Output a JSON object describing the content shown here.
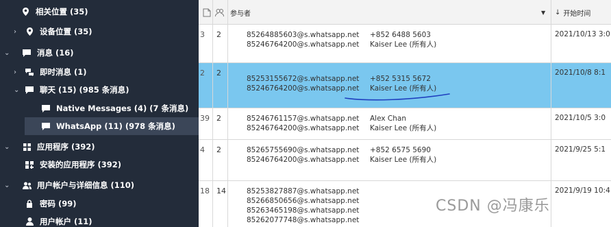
{
  "sidebar": {
    "items": [
      {
        "label": "相关位置 (35)",
        "icon": "location-pin-icon"
      },
      {
        "label": "设备位置 (35)",
        "icon": "location-pin-icon"
      },
      {
        "label": "消息 (16)",
        "icon": "message-icon"
      },
      {
        "label": "即时消息 (1)",
        "icon": "chat-bubbles-icon"
      },
      {
        "label": "聊天 (15) (985 条消息)",
        "icon": "message-icon"
      },
      {
        "label": "Native Messages (4) (7 条消息)",
        "icon": "message-icon"
      },
      {
        "label": "WhatsApp (11) (978 条消息)",
        "icon": "message-icon"
      },
      {
        "label": "应用程序 (392)",
        "icon": "apps-grid-icon"
      },
      {
        "label": "安装的应用程序 (392)",
        "icon": "installed-apps-icon"
      },
      {
        "label": "用户帐户与详细信息 (110)",
        "icon": "users-icon"
      },
      {
        "label": "密码 (99)",
        "icon": "lock-icon"
      },
      {
        "label": "用户帐户 (11)",
        "icon": "user-icon"
      }
    ]
  },
  "grid": {
    "columns": {
      "participants": "参与者",
      "start_time": "开始时间",
      "sort_indicator": "↓"
    },
    "rows": [
      {
        "edge": "3",
        "count": "2",
        "participants": [
          {
            "addr": "85264885603@s.whatsapp.net",
            "name": "+852 6488 5603"
          },
          {
            "addr": "85246764200@s.whatsapp.net",
            "name": "Kaiser Lee (所有人)"
          }
        ],
        "time": "2021/10/13 3:0"
      },
      {
        "edge": "2",
        "count": "2",
        "participants": [
          {
            "addr": "85253155672@s.whatsapp.net",
            "name": "+852 5315 5672"
          },
          {
            "addr": "85246764200@s.whatsapp.net",
            "name": "Kaiser Lee (所有人)"
          }
        ],
        "time": "2021/10/8 8:1"
      },
      {
        "edge": "39",
        "count": "2",
        "participants": [
          {
            "addr": "85246761157@s.whatsapp.net",
            "name": "Alex Chan"
          },
          {
            "addr": "85246764200@s.whatsapp.net",
            "name": "Kaiser Lee (所有人)"
          }
        ],
        "time": "2021/10/5 3:0"
      },
      {
        "edge": "4",
        "count": "2",
        "participants": [
          {
            "addr": "85265755690@s.whatsapp.net",
            "name": "+852 6575 5690"
          },
          {
            "addr": "85246764200@s.whatsapp.net",
            "name": "Kaiser Lee (所有人)"
          }
        ],
        "time": "2021/9/25 5:1"
      },
      {
        "edge": "18",
        "count": "14",
        "participants": [
          {
            "addr": "85253827887@s.whatsapp.net",
            "name": ""
          },
          {
            "addr": "85266850656@s.whatsapp.net",
            "name": ""
          },
          {
            "addr": "85263465198@s.whatsapp.net",
            "name": ""
          },
          {
            "addr": "85262077748@s.whatsapp.net",
            "name": ""
          }
        ],
        "time": "2021/9/19 10:4"
      }
    ]
  },
  "watermark": "CSDN @冯康乐",
  "colors": {
    "sidebar_bg": "#232c3a",
    "sidebar_selected": "#3b4658",
    "row_selected": "#7ac7ef",
    "annotation_stroke": "#1f3fbf"
  }
}
